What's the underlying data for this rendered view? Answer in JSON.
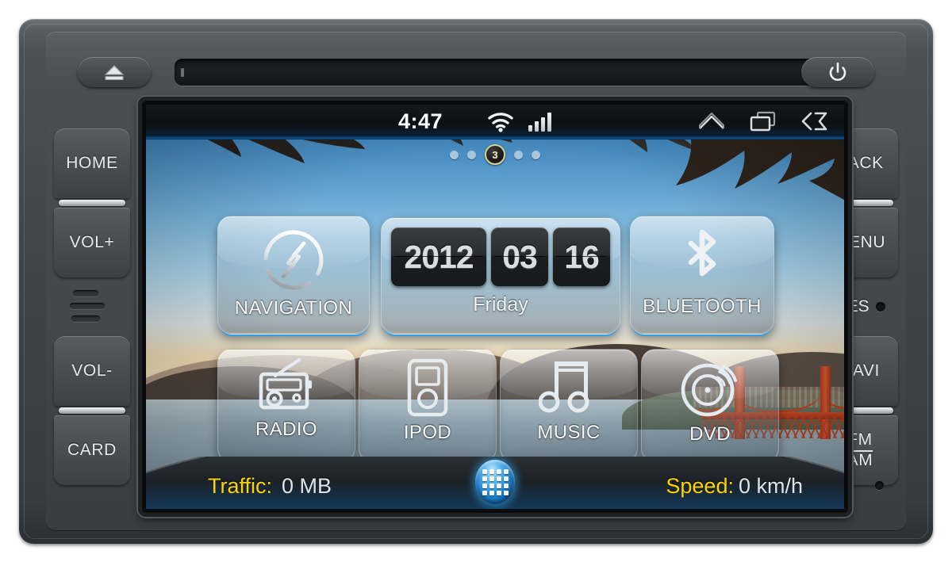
{
  "device": {
    "name": "car-head-unit",
    "top_controls": {
      "eject_label": "eject-icon",
      "power_label": "power-icon",
      "disc_slot_label": "disc-slot"
    },
    "left_buttons": [
      {
        "label": "HOME",
        "name": "home-button"
      },
      {
        "label": "VOL+",
        "name": "volume-up-button"
      },
      {
        "label": "VOL-",
        "name": "volume-down-button"
      },
      {
        "label": "CARD",
        "name": "card-button"
      }
    ],
    "right_buttons": [
      {
        "label": "BACK",
        "name": "back-button"
      },
      {
        "label": "MENU",
        "name": "menu-button"
      },
      {
        "label": "RES",
        "name": "reset-button"
      },
      {
        "label": "NAVI",
        "name": "navi-button"
      },
      {
        "label": "FM",
        "label2": "AM",
        "name": "fm-am-button"
      }
    ]
  },
  "statusbar": {
    "time": "4:47",
    "wifi_icon": "wifi-icon",
    "signal_icon": "signal-bars-icon",
    "signal_bars": 4,
    "nav_icons": [
      "home-icon",
      "recent-apps-icon",
      "back-icon"
    ]
  },
  "pager": {
    "total": 5,
    "current_index": 2,
    "current_label": "3"
  },
  "home": {
    "tiles_row1": [
      {
        "label": "NAVIGATION",
        "icon": "compass-icon",
        "name": "tile-navigation"
      },
      {
        "label": "BLUETOOTH",
        "icon": "bluetooth-icon",
        "name": "tile-bluetooth"
      }
    ],
    "date_widget": {
      "year": "2012",
      "month": "03",
      "day": "16",
      "weekday": "Friday"
    },
    "tiles_row2": [
      {
        "label": "RADIO",
        "icon": "radio-icon",
        "name": "tile-radio"
      },
      {
        "label": "IPOD",
        "icon": "ipod-icon",
        "name": "tile-ipod"
      },
      {
        "label": "MUSIC",
        "icon": "music-note-icon",
        "name": "tile-music"
      },
      {
        "label": "DVD",
        "icon": "disc-icon",
        "name": "tile-dvd"
      }
    ]
  },
  "dock": {
    "traffic_label": "Traffic:",
    "traffic_value": "0 MB",
    "speed_label": "Speed:",
    "speed_value": "0 km/h",
    "drawer_icon": "app-drawer-grid-icon"
  },
  "colors": {
    "accent_blue": "#2ba0eb",
    "label_yellow": "#ffd500",
    "chassis_dark": "#3e4448",
    "screen_black": "#0a0b0c"
  }
}
